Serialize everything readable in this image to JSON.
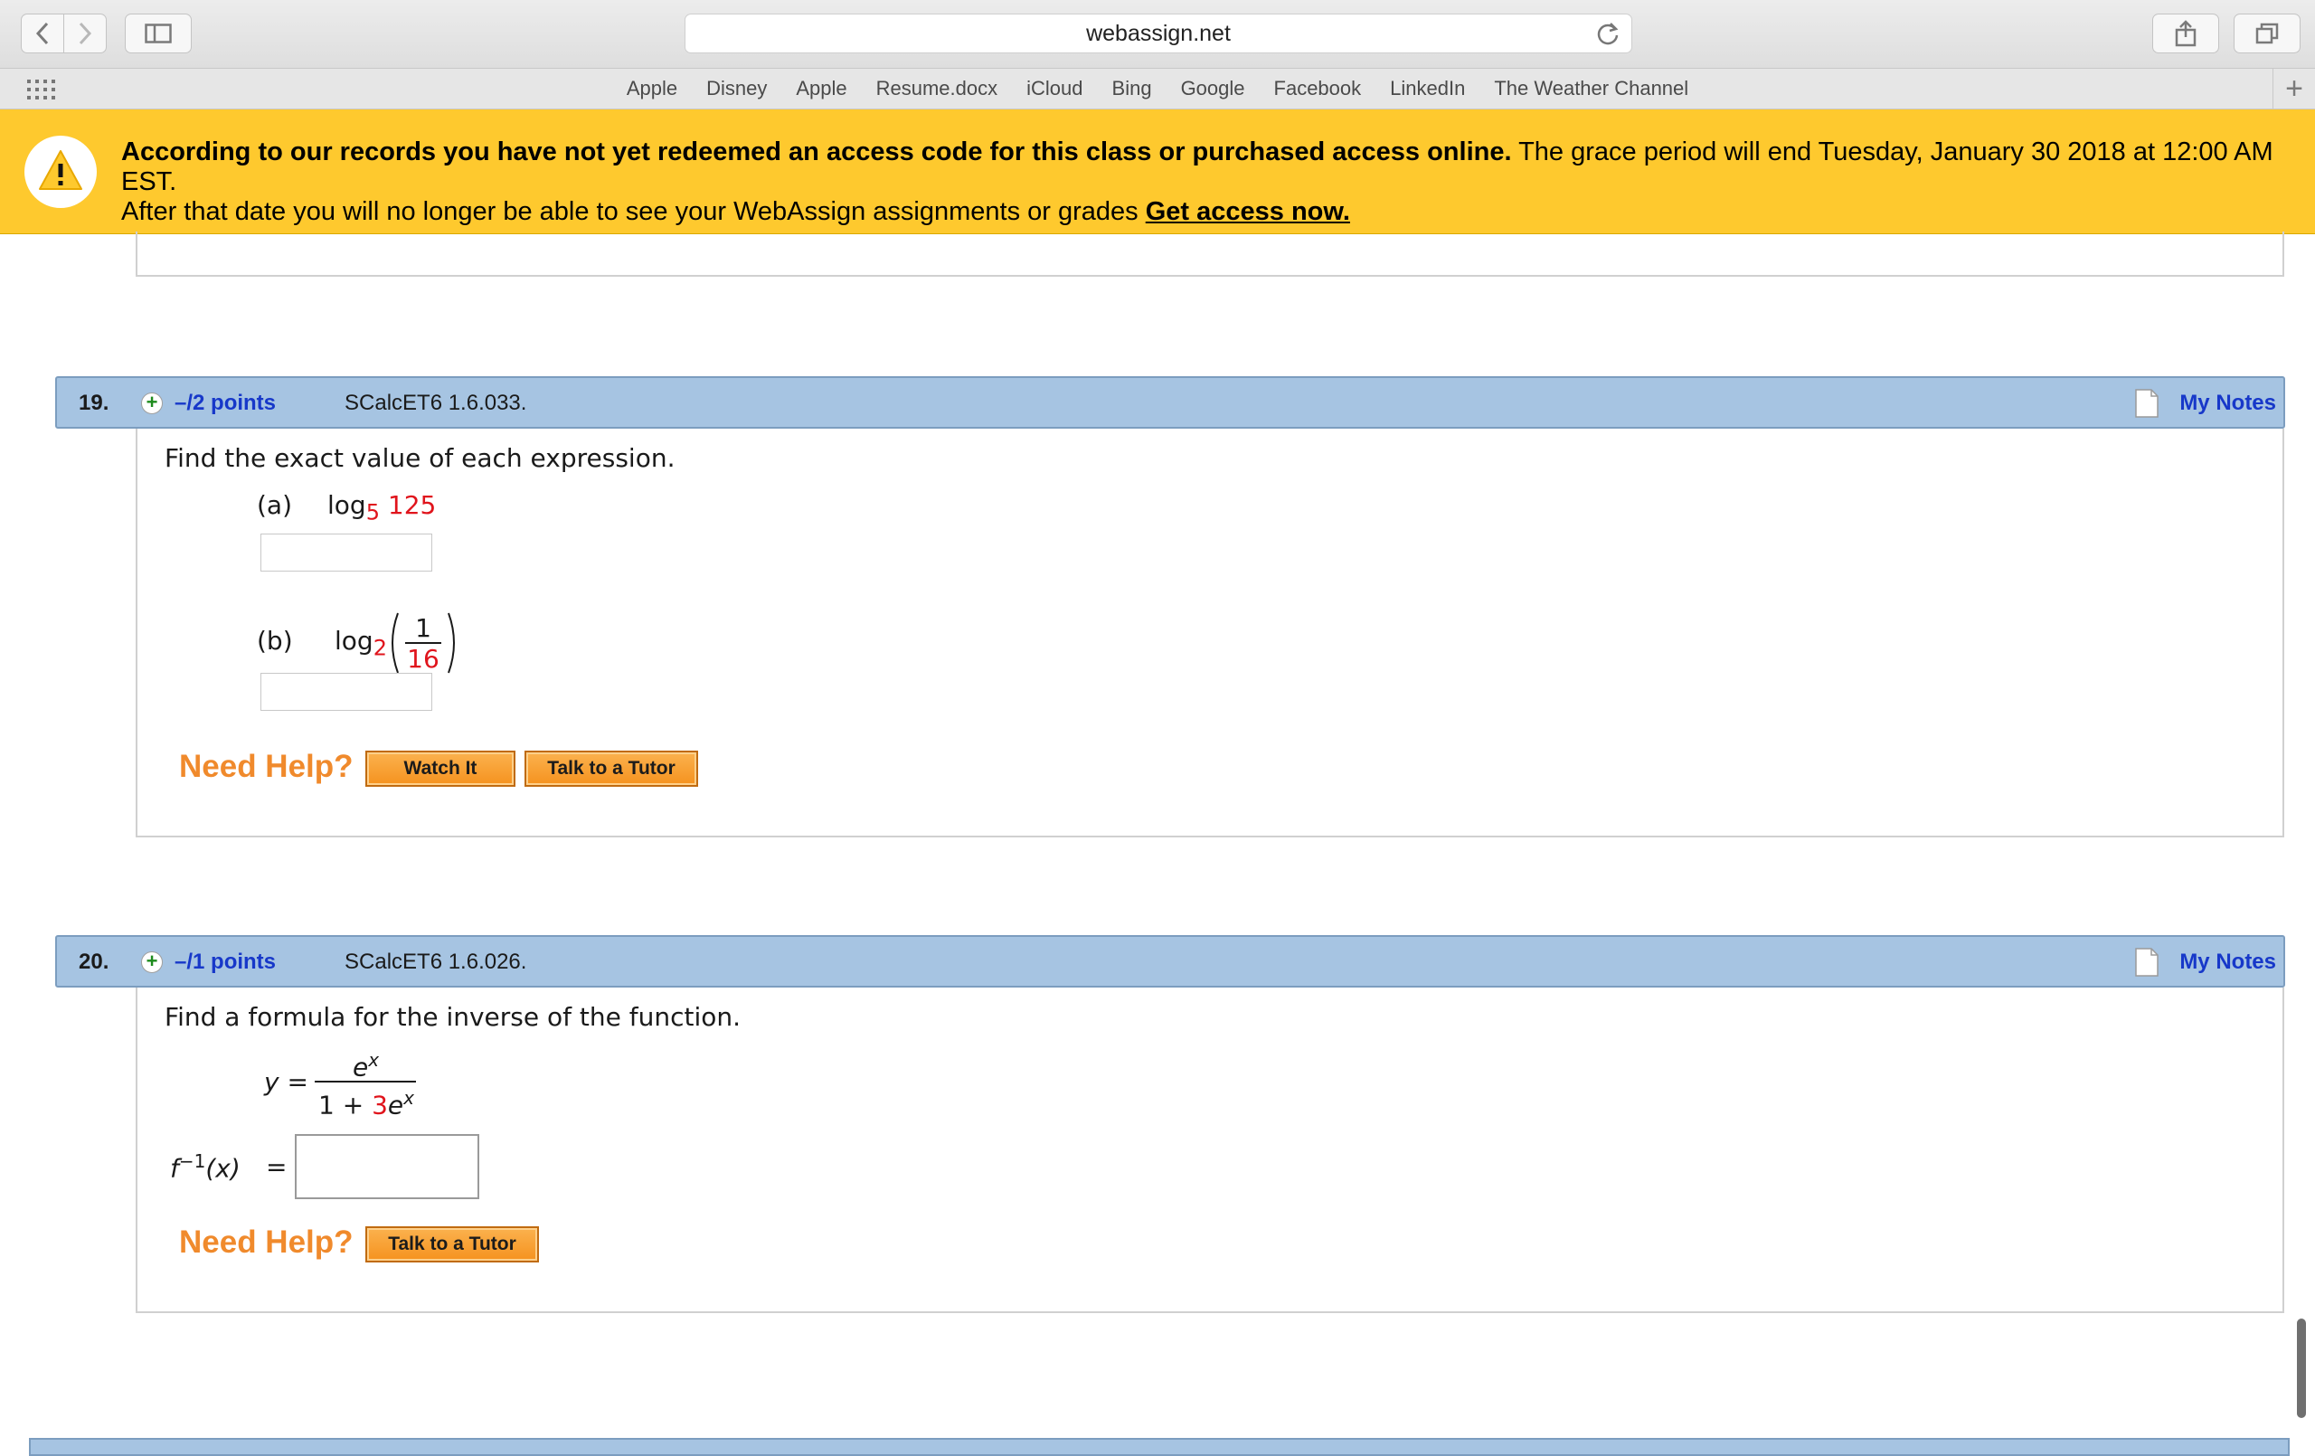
{
  "browser": {
    "url": "webassign.net",
    "favorites": [
      "Apple",
      "Disney",
      "Apple",
      "Resume.docx",
      "iCloud",
      "Bing",
      "Google",
      "Facebook",
      "LinkedIn",
      "The Weather Channel"
    ],
    "plus": "+"
  },
  "banner": {
    "bold": "According to our records you have not yet redeemed an access code for this class or purchased access online.",
    "normal1": " The grace period will end Tuesday, January 30 2018 at 12:00 AM EST.",
    "normal2": "After that date you will no longer be able to see your WebAssign assignments or grades ",
    "link": "Get access now."
  },
  "questions": [
    {
      "number": "19.",
      "points": "–/2 points",
      "code": "SCalcET6 1.6.033.",
      "notes": "My Notes",
      "prompt": "Find the exact value of each expression.",
      "part_a": {
        "label": "(a)",
        "log": "log",
        "base": "5",
        "arg": "125"
      },
      "part_b": {
        "label": "(b)",
        "log": "log",
        "base": "2",
        "num": "1",
        "den": "16"
      },
      "help_label": "Need Help?",
      "buttons": [
        "Watch It",
        "Talk to a Tutor"
      ]
    },
    {
      "number": "20.",
      "points": "–/1 points",
      "code": "SCalcET6 1.6.026.",
      "notes": "My Notes",
      "prompt": "Find a formula for the inverse of the function.",
      "y_label": "y =",
      "numerator": "e",
      "exp": "x",
      "den_one": "1 + ",
      "den_coef": "3",
      "den_e": "e",
      "f_inv": "f",
      "f_exp": "−1",
      "f_arg": "(x)",
      "equals": "=",
      "help_label": "Need Help?",
      "buttons": [
        "Talk to a Tutor"
      ]
    }
  ]
}
